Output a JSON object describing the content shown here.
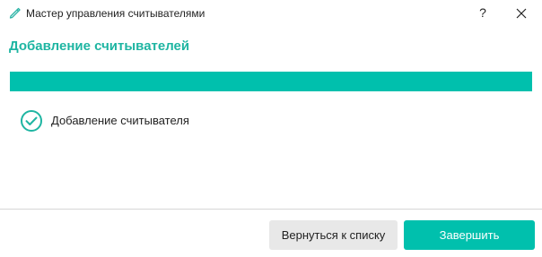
{
  "window": {
    "title": "Мастер управления считывателями",
    "help_label": "?",
    "icons": {
      "app": "pen-icon",
      "close": "close-icon"
    }
  },
  "main": {
    "heading": "Добавление считывателей",
    "progress": 1.0,
    "steps": [
      {
        "label": "Добавление считывателя",
        "status": "done",
        "icon": "check-circle-icon"
      }
    ]
  },
  "footer": {
    "back_label": "Вернуться к списку",
    "finish_label": "Завершить"
  },
  "colors": {
    "accent": "#00c0ad",
    "heading": "#1eb5a2",
    "secondary_button": "#e8e8e8"
  }
}
